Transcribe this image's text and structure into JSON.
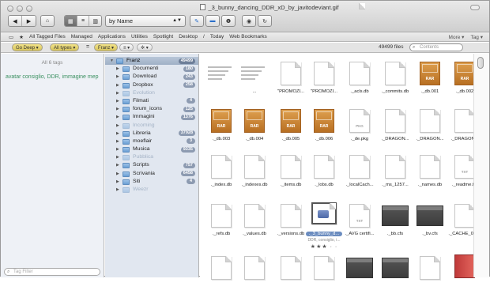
{
  "window": {
    "title": "_3_bunny_dancing_DDR_xD_by_javitodeviant.gif"
  },
  "toolbar": {
    "sort_value": "by Name",
    "back_icon": "back-icon",
    "forward_icon": "forward-icon",
    "home_icon": "home-icon",
    "view_icons": [
      "icon-view-icon",
      "list-view-icon",
      "column-view-icon"
    ],
    "tag_icon": "tag-icon",
    "folder_icon": "folder-icon",
    "info_icon": "info-icon",
    "quicklook_icon": "quicklook-icon",
    "refresh_icon": "refresh-icon"
  },
  "favorites": {
    "items": [
      "All Tagged Files",
      "Managed",
      "Applications",
      "Utilities",
      "Spotlight",
      "Desktop",
      "/",
      "Today",
      "Web Bookmarks"
    ],
    "more_label": "More ▾",
    "tag_menu_label": "Tag ▾"
  },
  "filter": {
    "deep_label": "Go Deep ▾",
    "types_label": "All types ▾",
    "eq_label": "=",
    "path_label": "Franz ▾",
    "count_text": "49499 files",
    "search_placeholder": "Contents"
  },
  "tags_panel": {
    "header": "All 6 tags",
    "tags_text": "avatar  consiglio,  DDR,  immagine  mep",
    "filter_placeholder": "Tag Filter"
  },
  "tree": [
    {
      "label": "Franz",
      "badge": "49499",
      "level": 0,
      "selected": true,
      "expanded": true,
      "dim": false
    },
    {
      "label": "Documenti",
      "badge": "180",
      "level": 1,
      "selected": false,
      "expanded": false,
      "dim": false
    },
    {
      "label": "Download",
      "badge": "243",
      "level": 1,
      "selected": false,
      "expanded": false,
      "dim": false
    },
    {
      "label": "Dropbox",
      "badge": "258",
      "level": 1,
      "selected": false,
      "expanded": false,
      "dim": false
    },
    {
      "label": "Evolution",
      "badge": "",
      "level": 1,
      "selected": false,
      "expanded": false,
      "dim": true
    },
    {
      "label": "Filmati",
      "badge": "4",
      "level": 1,
      "selected": false,
      "expanded": false,
      "dim": false
    },
    {
      "label": "forum_icons",
      "badge": "125",
      "level": 1,
      "selected": false,
      "expanded": false,
      "dim": false
    },
    {
      "label": "Immagini",
      "badge": "1376",
      "level": 1,
      "selected": false,
      "expanded": false,
      "dim": false
    },
    {
      "label": "Incoming",
      "badge": "",
      "level": 1,
      "selected": false,
      "expanded": false,
      "dim": true
    },
    {
      "label": "Libreria",
      "badge": "37928",
      "level": 1,
      "selected": false,
      "expanded": false,
      "dim": false
    },
    {
      "label": "moeflair",
      "badge": "3",
      "level": 1,
      "selected": false,
      "expanded": false,
      "dim": false
    },
    {
      "label": "Musica",
      "badge": "9335",
      "level": 1,
      "selected": false,
      "expanded": false,
      "dim": false
    },
    {
      "label": "Pubblica",
      "badge": "",
      "level": 1,
      "selected": false,
      "expanded": false,
      "dim": true
    },
    {
      "label": "Scripts",
      "badge": "757",
      "level": 1,
      "selected": false,
      "expanded": false,
      "dim": false
    },
    {
      "label": "Scrivania",
      "badge": "6458",
      "level": 1,
      "selected": false,
      "expanded": false,
      "dim": false
    },
    {
      "label": "Siti",
      "badge": "4",
      "level": 1,
      "selected": false,
      "expanded": false,
      "dim": false
    },
    {
      "label": "Weezr",
      "badge": "",
      "level": 1,
      "selected": false,
      "expanded": false,
      "dim": true
    }
  ],
  "files": [
    {
      "name": "",
      "kind": "wide"
    },
    {
      "name": "...",
      "kind": "wide"
    },
    {
      "name": "\"PROMOZI...",
      "kind": "doc"
    },
    {
      "name": "\"PROMOZI...",
      "kind": "doc"
    },
    {
      "name": "._acls.db",
      "kind": "doc"
    },
    {
      "name": "._commits.db",
      "kind": "doc"
    },
    {
      "name": "._db.001",
      "kind": "rar"
    },
    {
      "name": "._db.002",
      "kind": "rar"
    },
    {
      "name": "._db.003",
      "kind": "rar"
    },
    {
      "name": "._db.004",
      "kind": "rar"
    },
    {
      "name": "._db.005",
      "kind": "rar"
    },
    {
      "name": "._db.006",
      "kind": "rar"
    },
    {
      "name": "._de.pkg",
      "kind": "doc",
      "label": "PKG"
    },
    {
      "name": "._DRAGON...",
      "kind": "doc"
    },
    {
      "name": "._DRAGON...",
      "kind": "doc"
    },
    {
      "name": "._DRAGON...",
      "kind": "doc"
    },
    {
      "name": "._index.db",
      "kind": "doc"
    },
    {
      "name": "._indexes.db",
      "kind": "doc"
    },
    {
      "name": "._items.db",
      "kind": "doc"
    },
    {
      "name": "._lobs.db",
      "kind": "doc"
    },
    {
      "name": "._localCach...",
      "kind": "doc"
    },
    {
      "name": "._ms_1257...",
      "kind": "doc"
    },
    {
      "name": "._names.db",
      "kind": "doc"
    },
    {
      "name": "._readme.txt",
      "kind": "doc",
      "label": "TXT"
    },
    {
      "name": "._refs.db",
      "kind": "doc"
    },
    {
      "name": "._values.db",
      "kind": "doc"
    },
    {
      "name": "._versions.db",
      "kind": "doc"
    },
    {
      "name": "._3_bunny_d...",
      "kind": "image",
      "selected": true,
      "subtitle": "DDR, consiglio, i...",
      "rating": "★★★ · ·"
    },
    {
      "name": "._AVG certifi...",
      "kind": "doc",
      "label": "TXT"
    },
    {
      "name": "._bb.cfs",
      "kind": "dark"
    },
    {
      "name": "._bv.cfs",
      "kind": "dark"
    },
    {
      "name": "._CACHE_001_",
      "kind": "doc"
    },
    {
      "name": "",
      "kind": "doc"
    },
    {
      "name": "",
      "kind": "doc"
    },
    {
      "name": "",
      "kind": "doc"
    },
    {
      "name": "",
      "kind": "doc"
    },
    {
      "name": "",
      "kind": "dark"
    },
    {
      "name": "",
      "kind": "dark"
    },
    {
      "name": "",
      "kind": "doc"
    },
    {
      "name": "",
      "kind": "book"
    }
  ]
}
